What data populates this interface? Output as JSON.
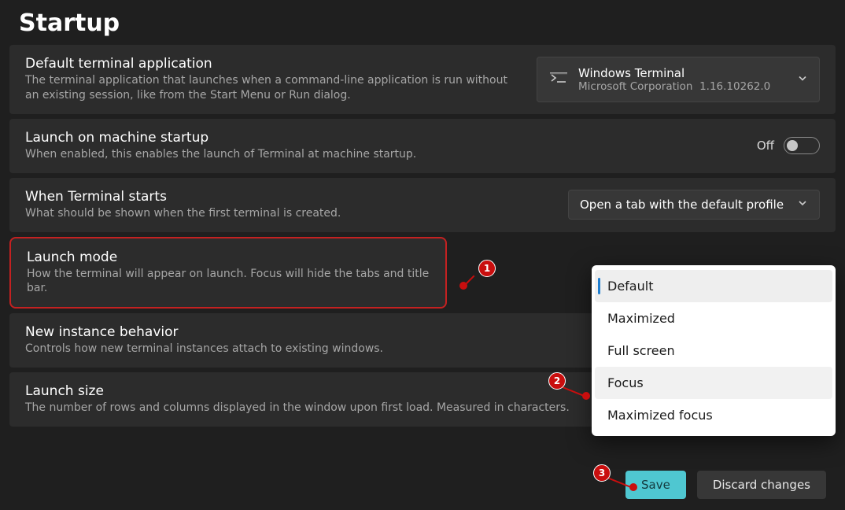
{
  "page": {
    "title": "Startup"
  },
  "settings": {
    "default_terminal": {
      "title": "Default terminal application",
      "desc": "The terminal application that launches when a command-line application is run without an existing session, like from the Start Menu or Run dialog.",
      "value_name": "Windows Terminal",
      "value_publisher": "Microsoft Corporation",
      "value_version": "1.16.10262.0"
    },
    "launch_on_startup": {
      "title": "Launch on machine startup",
      "desc": "When enabled, this enables the launch of Terminal at machine startup.",
      "state_label": "Off"
    },
    "when_starts": {
      "title": "When Terminal starts",
      "desc": "What should be shown when the first terminal is created.",
      "value": "Open a tab with the default profile"
    },
    "launch_mode": {
      "title": "Launch mode",
      "desc": "How the terminal will appear on launch. Focus will hide the tabs and title bar.",
      "options": [
        "Default",
        "Maximized",
        "Full screen",
        "Focus",
        "Maximized focus"
      ],
      "selected_index": 0,
      "hover_index": 3
    },
    "new_instance": {
      "title": "New instance behavior",
      "desc": "Controls how new terminal instances attach to existing windows."
    },
    "launch_size": {
      "title": "Launch size",
      "desc": "The number of rows and columns displayed in the window upon first load. Measured in characters."
    }
  },
  "footer": {
    "save": "Save",
    "discard": "Discard changes"
  },
  "annotations": {
    "a1": "1",
    "a2": "2",
    "a3": "3"
  }
}
